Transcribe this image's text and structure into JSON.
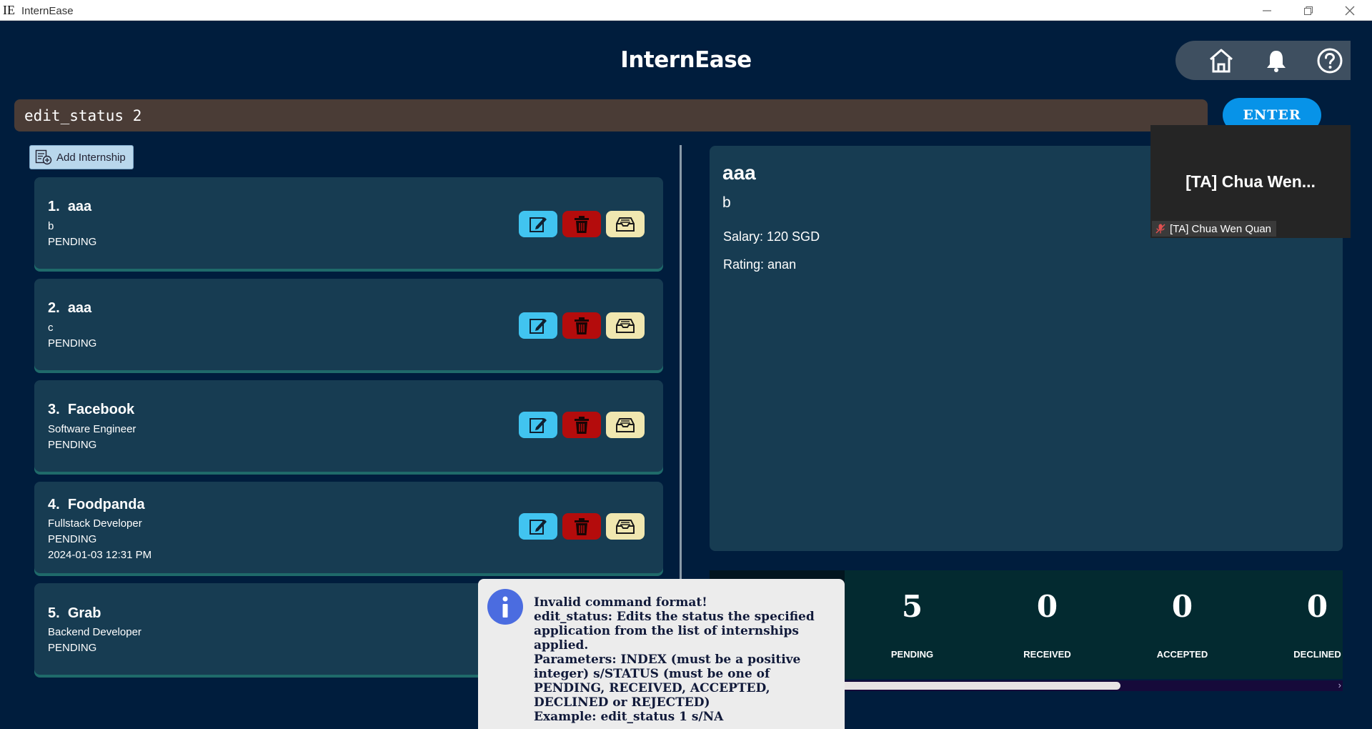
{
  "window": {
    "icon_text": "IE",
    "title": "InternEase"
  },
  "header": {
    "title": "InternEase"
  },
  "nav": {
    "home": "home-icon",
    "notifications": "bell-icon",
    "help": "help-icon"
  },
  "command": {
    "value": "edit_status 2",
    "enter_label": "ENTER"
  },
  "toolbar": {
    "add_label": "Add Internship"
  },
  "internships": [
    {
      "index": "1.",
      "company": "aaa",
      "role": "b",
      "status": "PENDING",
      "date": ""
    },
    {
      "index": "2.",
      "company": "aaa",
      "role": "c",
      "status": "PENDING",
      "date": ""
    },
    {
      "index": "3.",
      "company": "Facebook",
      "role": "Software Engineer",
      "status": "PENDING",
      "date": ""
    },
    {
      "index": "4.",
      "company": "Foodpanda",
      "role": "Fullstack Developer",
      "status": "PENDING",
      "date": "2024-01-03 12:31 PM"
    },
    {
      "index": "5.",
      "company": "Grab",
      "role": "Backend Developer",
      "status": "PENDING",
      "date": ""
    }
  ],
  "detail": {
    "company": "aaa",
    "role": "b",
    "salary": "Salary: 120 SGD",
    "rating": "Rating: anan"
  },
  "video": {
    "name": "[TA] Chua Wen...",
    "label": "[TA] Chua Wen Quan"
  },
  "stats": [
    {
      "value": "5",
      "label": "PENDING"
    },
    {
      "value": "0",
      "label": "RECEIVED"
    },
    {
      "value": "0",
      "label": "ACCEPTED"
    },
    {
      "value": "0",
      "label": "DECLINED"
    }
  ],
  "popup": {
    "lines": [
      "Invalid command format!",
      "edit_status: Edits the status the specified application from the list of internships applied.",
      "Parameters: INDEX (must be a positive integer) s/STATUS (must be one of PENDING, RECEIVED, ACCEPTED, DECLINED or REJECTED)",
      "Example: edit_status 1 s/NA"
    ]
  },
  "colors": {
    "background": "#001d3d",
    "card": "#173c52",
    "edit": "#41c4f0",
    "delete": "#b40c0c",
    "archive": "#f0e7b0",
    "enter": "#0793e8"
  }
}
